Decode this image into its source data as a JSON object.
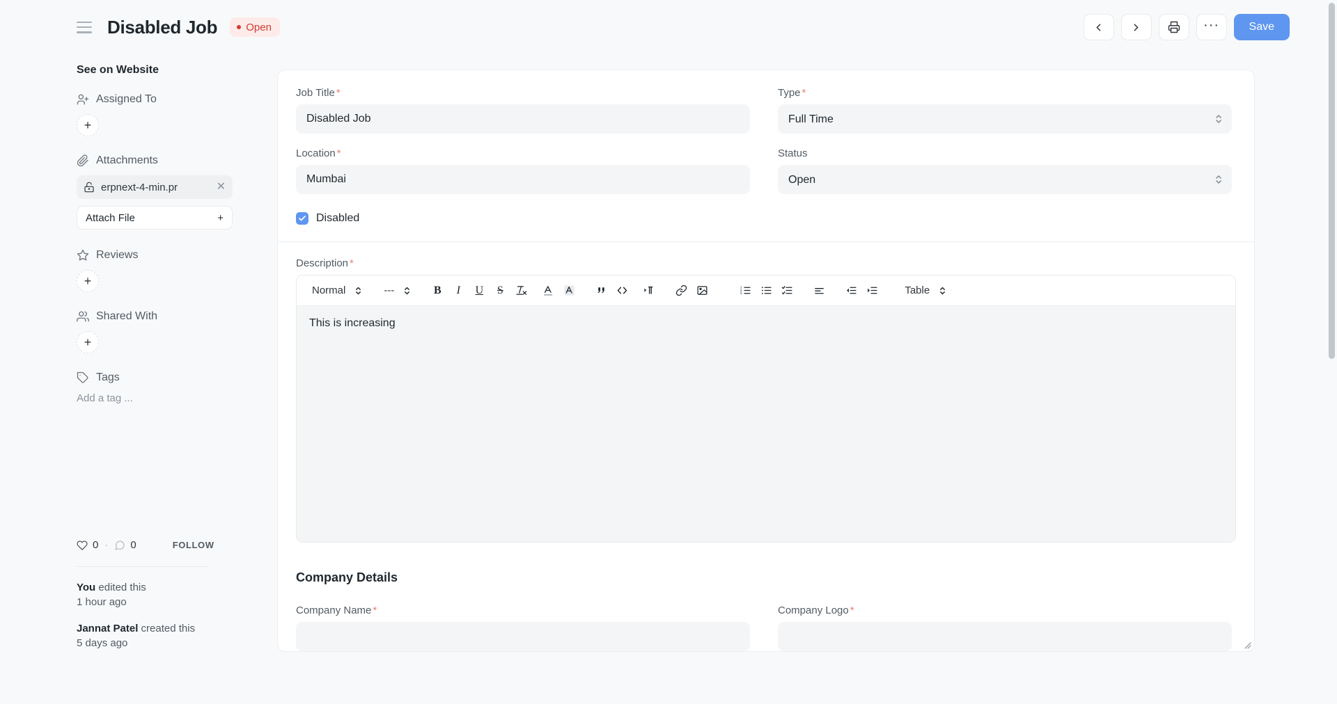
{
  "header": {
    "menu_icon": "hamburger-icon",
    "title": "Disabled Job",
    "status": "Open",
    "actions": {
      "prev": "prev-icon",
      "next": "next-icon",
      "print": "print-icon",
      "more": "···",
      "save_label": "Save"
    }
  },
  "sidebar": {
    "see_on_website": "See on Website",
    "assigned_to": {
      "label": "Assigned To",
      "add": "+"
    },
    "attachments": {
      "label": "Attachments",
      "file_name": "erpnext-4-min.pr",
      "remove": "✕",
      "attach_button": "Attach File",
      "attach_plus": "+"
    },
    "reviews": {
      "label": "Reviews",
      "add": "+"
    },
    "shared_with": {
      "label": "Shared With",
      "add": "+"
    },
    "tags": {
      "label": "Tags",
      "placeholder": "Add a tag ..."
    },
    "meta": {
      "likes": "0",
      "separator": "·",
      "comments": "0",
      "follow": "FOLLOW"
    },
    "activity": [
      {
        "actor": "You",
        "action": " edited this",
        "time": "1 hour ago"
      },
      {
        "actor": "Jannat Patel",
        "action": " created this",
        "time": "5 days ago"
      }
    ]
  },
  "form": {
    "job_title": {
      "label": "Job Title",
      "required": "*",
      "value": "Disabled Job"
    },
    "location": {
      "label": "Location",
      "required": "*",
      "value": "Mumbai"
    },
    "type": {
      "label": "Type",
      "required": "*",
      "value": "Full Time"
    },
    "status": {
      "label": "Status",
      "value": "Open"
    },
    "disabled": {
      "label": "Disabled",
      "checked": true
    }
  },
  "description": {
    "label": "Description",
    "required": "*",
    "toolbar": {
      "style_dropdown": "Normal",
      "font_dropdown": "---",
      "bold": "B",
      "italic": "I",
      "underline": "U",
      "strikethrough": "S",
      "clear_format": "clear-format-icon",
      "text_color": "text-color-icon",
      "highlight": "highlight-icon",
      "blockquote": "blockquote-icon",
      "code": "code-icon",
      "direction": "text-direction-icon",
      "link": "link-icon",
      "image": "image-icon",
      "ordered_list": "ordered-list-icon",
      "bullet_list": "bullet-list-icon",
      "checklist": "checklist-icon",
      "align": "align-icon",
      "outdent": "outdent-icon",
      "indent": "indent-icon",
      "table_dropdown": "Table"
    },
    "content": "This is increasing"
  },
  "company_details": {
    "title": "Company Details",
    "company_name": {
      "label": "Company Name",
      "required": "*"
    },
    "company_logo": {
      "label": "Company Logo",
      "required": "*"
    }
  },
  "colors": {
    "accent": "#5e96f0",
    "status_red": "#cf3c31",
    "status_bg": "#fdebe9",
    "page_bg": "#f8f9fa",
    "input_bg": "#f4f5f6"
  }
}
